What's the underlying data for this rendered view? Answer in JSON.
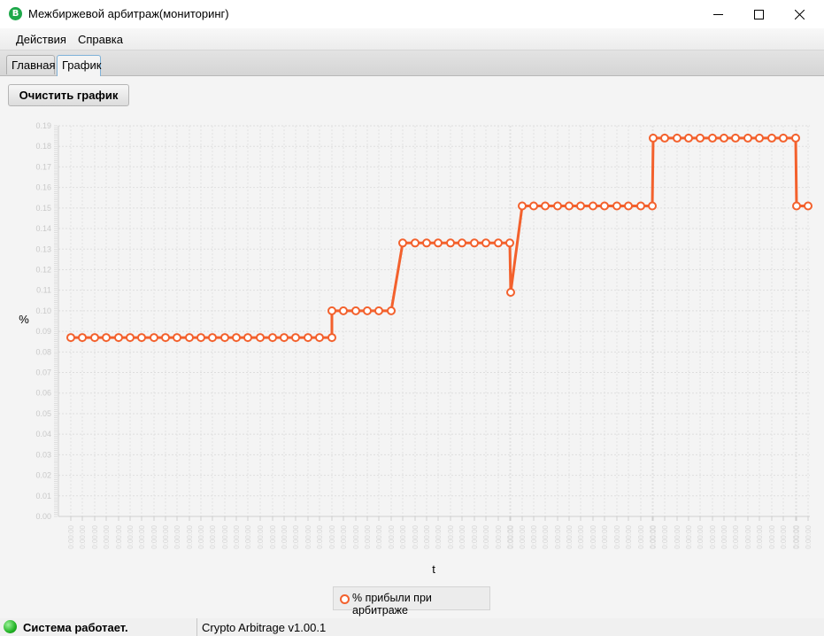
{
  "window": {
    "title": "Межбиржевой арбитраж(мониторинг)",
    "app_icon": "bitcoin-icon"
  },
  "menu": {
    "items": [
      {
        "label": "Действия"
      },
      {
        "label": "Справка"
      }
    ]
  },
  "tabs": [
    {
      "label": "Главная",
      "active": false
    },
    {
      "label": "График",
      "active": true
    }
  ],
  "toolbar": {
    "clear_label": "Очистить график"
  },
  "status": {
    "text": "Система работает.",
    "version": "Crypto Arbitrage v1.00.1",
    "led_color": "#22b325"
  },
  "colors": {
    "series": "#f3612d",
    "accent": "#7fb2d8"
  },
  "legend": {
    "label": "% прибыли при арбитраже"
  },
  "chart_data": {
    "type": "line",
    "xlabel": "t",
    "ylabel": "%",
    "ylim": [
      0,
      0.19
    ],
    "ytick_step": 0.01,
    "ytick_labels": [
      "0.00",
      "0.01",
      "0.02",
      "0.03",
      "0.04",
      "0.05",
      "0.06",
      "0.07",
      "0.08",
      "0.09",
      "0.10",
      "0.11",
      "0.12",
      "0.13",
      "0.14",
      "0.15",
      "0.16",
      "0.17",
      "0.18",
      "0.19"
    ],
    "grid": true,
    "legend_position": "bottom",
    "series": [
      {
        "name": "% прибыли при арбитраже",
        "values": [
          0.087,
          0.087,
          0.087,
          0.087,
          0.087,
          0.087,
          0.087,
          0.087,
          0.087,
          0.087,
          0.087,
          0.087,
          0.087,
          0.087,
          0.087,
          0.087,
          0.087,
          0.087,
          0.087,
          0.087,
          0.087,
          0.087,
          0.087,
          0.087,
          0.087,
          0.087,
          0.087,
          0.087,
          0.087,
          0.087,
          0.1,
          0.1,
          0.1,
          0.1,
          0.1,
          0.1,
          0.133,
          0.133,
          0.133,
          0.133,
          0.133,
          0.133,
          0.133,
          0.133,
          0.133,
          0.109,
          0.151,
          0.151,
          0.151,
          0.151,
          0.151,
          0.151,
          0.151,
          0.151,
          0.151,
          0.151,
          0.151,
          0.151,
          0.184,
          0.184,
          0.184,
          0.184,
          0.184,
          0.184,
          0.184,
          0.184,
          0.184,
          0.184,
          0.184,
          0.184,
          0.184,
          0.184,
          0.184,
          0.151,
          0.151
        ],
        "x_positions": [
          80,
          93,
          107,
          120,
          134,
          147,
          160,
          174,
          187,
          200,
          214,
          227,
          240,
          254,
          267,
          280,
          294,
          308,
          321,
          334,
          348,
          361,
          375,
          375,
          375,
          375,
          375,
          375,
          375,
          375,
          375,
          388,
          402,
          415,
          428,
          442,
          455,
          469,
          482,
          495,
          509,
          522,
          536,
          549,
          563,
          576,
          577,
          590,
          603,
          616,
          630,
          643,
          656,
          670,
          683,
          697,
          710,
          724,
          737,
          738,
          751,
          765,
          778,
          791,
          805,
          818,
          831,
          845,
          858,
          872,
          885,
          899,
          900,
          913
        ],
        "step_points": [
          [
            80,
            0.087
          ],
          [
            93,
            0.087
          ],
          [
            107,
            0.087
          ],
          [
            120,
            0.087
          ],
          [
            134,
            0.087
          ],
          [
            147,
            0.087
          ],
          [
            160,
            0.087
          ],
          [
            174,
            0.087
          ],
          [
            187,
            0.087
          ],
          [
            200,
            0.087
          ],
          [
            214,
            0.087
          ],
          [
            227,
            0.087
          ],
          [
            240,
            0.087
          ],
          [
            254,
            0.087
          ],
          [
            267,
            0.087
          ],
          [
            280,
            0.087
          ],
          [
            294,
            0.087
          ],
          [
            308,
            0.087
          ],
          [
            321,
            0.087
          ],
          [
            334,
            0.087
          ],
          [
            348,
            0.087
          ],
          [
            361,
            0.087
          ],
          [
            375,
            0.087
          ],
          [
            375,
            0.1
          ],
          [
            388,
            0.1
          ],
          [
            402,
            0.1
          ],
          [
            415,
            0.1
          ],
          [
            428,
            0.1
          ],
          [
            442,
            0.1
          ],
          [
            455,
            0.133
          ],
          [
            469,
            0.133
          ],
          [
            482,
            0.133
          ],
          [
            495,
            0.133
          ],
          [
            509,
            0.133
          ],
          [
            522,
            0.133
          ],
          [
            536,
            0.133
          ],
          [
            549,
            0.133
          ],
          [
            563,
            0.133
          ],
          [
            576,
            0.133
          ],
          [
            577,
            0.109
          ],
          [
            590,
            0.151
          ],
          [
            603,
            0.151
          ],
          [
            616,
            0.151
          ],
          [
            630,
            0.151
          ],
          [
            643,
            0.151
          ],
          [
            656,
            0.151
          ],
          [
            670,
            0.151
          ],
          [
            683,
            0.151
          ],
          [
            697,
            0.151
          ],
          [
            710,
            0.151
          ],
          [
            724,
            0.151
          ],
          [
            737,
            0.151
          ],
          [
            738,
            0.184
          ],
          [
            751,
            0.184
          ],
          [
            765,
            0.184
          ],
          [
            778,
            0.184
          ],
          [
            791,
            0.184
          ],
          [
            805,
            0.184
          ],
          [
            818,
            0.184
          ],
          [
            831,
            0.184
          ],
          [
            845,
            0.184
          ],
          [
            858,
            0.184
          ],
          [
            872,
            0.184
          ],
          [
            885,
            0.184
          ],
          [
            899,
            0.184
          ],
          [
            900,
            0.151
          ],
          [
            913,
            0.151
          ]
        ]
      }
    ]
  }
}
